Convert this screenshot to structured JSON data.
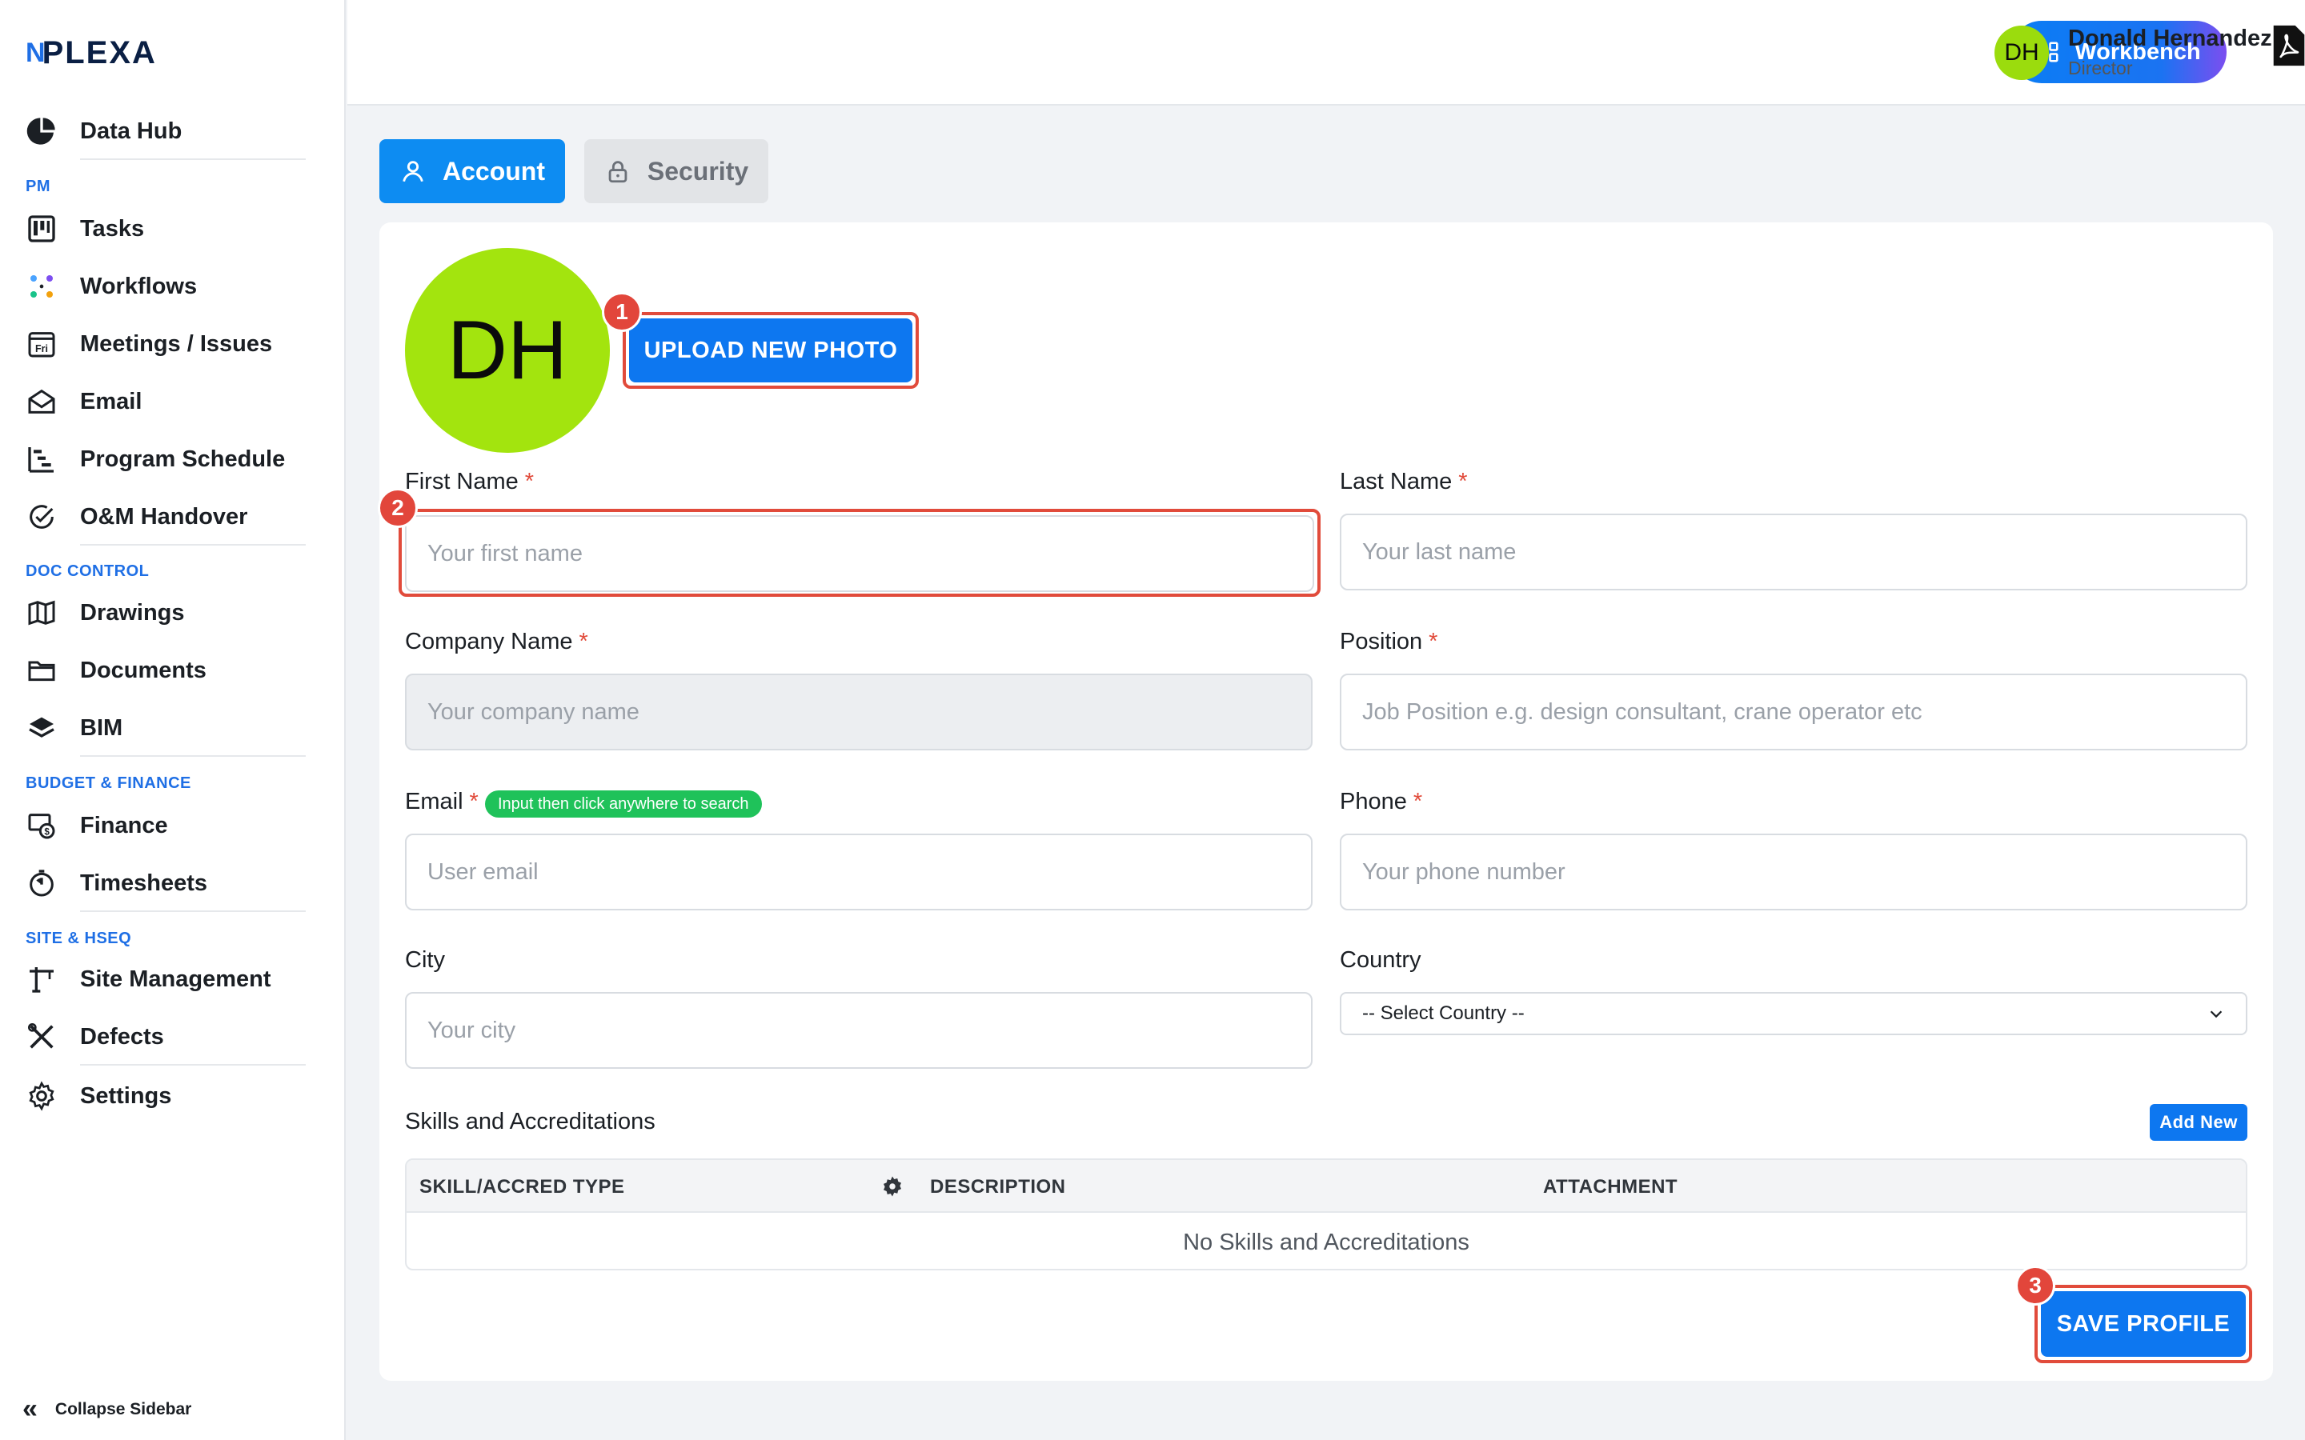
{
  "brand": {
    "mark": "N",
    "name": "PLEXA"
  },
  "sidebar": {
    "items": [
      {
        "label": "Data Hub",
        "icon": "pie-chart-icon"
      },
      {
        "label": "Tasks",
        "icon": "kanban-icon"
      },
      {
        "label": "Workflows",
        "icon": "workflow-icon"
      },
      {
        "label": "Meetings / Issues",
        "icon": "calendar-icon"
      },
      {
        "label": "Email",
        "icon": "envelope-icon"
      },
      {
        "label": "Program Schedule",
        "icon": "gantt-icon"
      },
      {
        "label": "O&M Handover",
        "icon": "check-circle-icon"
      },
      {
        "label": "Drawings",
        "icon": "map-icon"
      },
      {
        "label": "Documents",
        "icon": "folder-icon"
      },
      {
        "label": "BIM",
        "icon": "layers-icon"
      },
      {
        "label": "Finance",
        "icon": "finance-icon"
      },
      {
        "label": "Timesheets",
        "icon": "stopwatch-icon"
      },
      {
        "label": "Site Management",
        "icon": "crane-icon"
      },
      {
        "label": "Defects",
        "icon": "tools-icon"
      },
      {
        "label": "Settings",
        "icon": "gear-icon"
      }
    ],
    "sections": {
      "pm": "PM",
      "doc_control": "DOC CONTROL",
      "budget_finance": "BUDGET & FINANCE",
      "site_hseq": "SITE & HSEQ"
    },
    "collapse_label": "Collapse Sidebar",
    "calendar_day": "Fri"
  },
  "header": {
    "workbench_label": "Workbench",
    "avatar_initials": "DH",
    "user_name": "Donald Hernandez",
    "user_role": "Director"
  },
  "tabs": {
    "account": "Account",
    "security": "Security"
  },
  "profile": {
    "avatar_initials": "DH",
    "upload_label": "UPLOAD NEW PHOTO",
    "first_name": {
      "label": "First Name",
      "placeholder": "Your first name",
      "value": ""
    },
    "last_name": {
      "label": "Last Name",
      "placeholder": "Your last name",
      "value": ""
    },
    "company": {
      "label": "Company Name",
      "placeholder": "Your company name",
      "value": ""
    },
    "position": {
      "label": "Position",
      "placeholder": "Job Position e.g. design consultant, crane operator etc",
      "value": ""
    },
    "email": {
      "label": "Email",
      "placeholder": "User email",
      "value": "",
      "hint": "Input then click anywhere to search"
    },
    "phone": {
      "label": "Phone",
      "placeholder": "Your phone number",
      "value": ""
    },
    "city": {
      "label": "City",
      "placeholder": "Your city",
      "value": ""
    },
    "country": {
      "label": "Country",
      "selected": "-- Select Country --"
    },
    "required_mark": "*"
  },
  "skills": {
    "title": "Skills and Accreditations",
    "add_label": "Add New",
    "columns": [
      "SKILL/ACCRED TYPE",
      "DESCRIPTION",
      "ATTACHMENT"
    ],
    "empty_text": "No Skills and Accreditations"
  },
  "save_label": "SAVE PROFILE",
  "annotations": [
    "1",
    "2",
    "3"
  ],
  "colors": {
    "primary": "#0d77f0",
    "avatar": "#a3e40e",
    "highlight": "#e14b3b",
    "badge": "#1fc25a",
    "section": "#1f6fe5"
  }
}
